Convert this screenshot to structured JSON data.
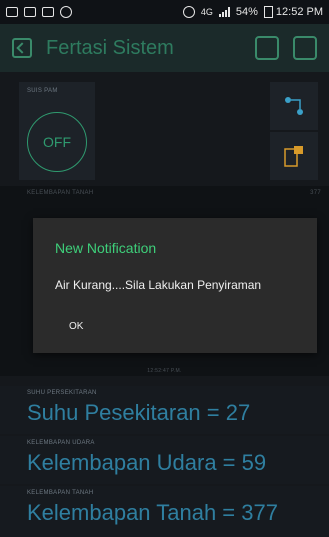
{
  "status_bar": {
    "battery": "54%",
    "time": "12:52 PM",
    "network": "4G"
  },
  "app_bar": {
    "title": "Fertasi Sistem"
  },
  "button_widget": {
    "label": "SUIS PAM",
    "state": "OFF"
  },
  "chart": {
    "label": "KELEMBAPAN TANAH",
    "value": "377",
    "time_label": "12:52:47 p.m."
  },
  "dialog": {
    "title": "New Notification",
    "message": "Air Kurang....Sila Lakukan Penyiraman",
    "ok": "OK"
  },
  "values": [
    {
      "label": "SUHU PERSEKITARAN",
      "text": "Suhu  Pesekitaran = 27"
    },
    {
      "label": "KELEMBAPAN UDARA",
      "text": "Kelembapan Udara = 59"
    },
    {
      "label": "KELEMBAPAN TANAH",
      "text": "Kelembapan Tanah = 377"
    }
  ]
}
